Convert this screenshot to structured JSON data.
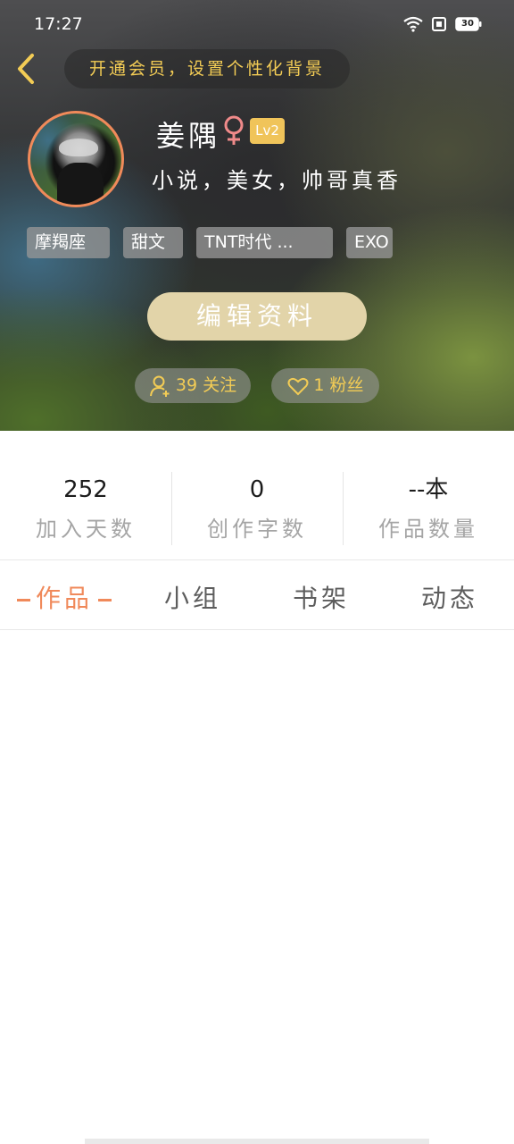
{
  "status_bar": {
    "time": "17:27",
    "battery": "30"
  },
  "header": {
    "back_icon": "chevron-left-icon",
    "vip_banner": "开通会员，设置个性化背景",
    "accent_color": "#f3cc55"
  },
  "profile": {
    "name": "姜隅",
    "gender_icon": "female-icon",
    "level": "Lv2",
    "bio": "小说，美女，帅哥真香",
    "tags": [
      "摩羯座",
      "甜文",
      "TNT时代 ...",
      "EXO"
    ],
    "edit_button": "编辑资料",
    "following": "39 关注",
    "followers": "1 粉丝"
  },
  "stats": [
    {
      "value": "252",
      "label": "加入天数"
    },
    {
      "value": "0",
      "label": "创作字数"
    },
    {
      "value": "--本",
      "label": "作品数量"
    }
  ],
  "tabs": [
    {
      "label": "作品",
      "active": true
    },
    {
      "label": "小组",
      "active": false
    },
    {
      "label": "书架",
      "active": false
    },
    {
      "label": "动态",
      "active": false
    }
  ],
  "colors": {
    "active_tab": "#f0895a",
    "level_badge": "#f0c45a",
    "edit_button": "#e2d4a9"
  }
}
